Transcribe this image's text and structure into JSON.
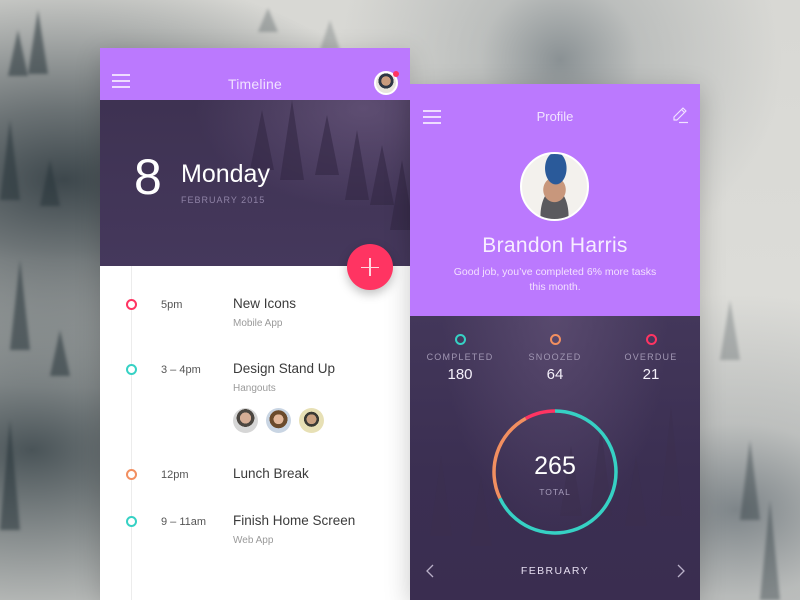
{
  "colors": {
    "accent_purple": "#bb79fe",
    "dark_purple": "#41355a",
    "fab_red": "#ff3462",
    "teal": "#36d1c4",
    "orange": "#f28f60",
    "red": "#ff3462"
  },
  "timeline": {
    "title": "Timeline",
    "menu_icon": "hamburger-menu-icon",
    "avatar_icon": "user-avatar",
    "notification": "notification-dot",
    "date": {
      "day": "8",
      "weekday": "Monday",
      "month_year": "FEBRUARY 2015"
    },
    "add_button": "+",
    "events": [
      {
        "time": "5pm",
        "title": "New Icons",
        "subtitle": "Mobile App",
        "color": "#ff3462"
      },
      {
        "time": "3 – 4pm",
        "title": "Design Stand Up",
        "subtitle": "Hangouts",
        "color": "#36d1c4",
        "attendees": 3
      },
      {
        "time": "12pm",
        "title": "Lunch Break",
        "subtitle": "",
        "color": "#f28f60"
      },
      {
        "time": "9 – 11am",
        "title": "Finish Home Screen",
        "subtitle": "Web App",
        "color": "#36d1c4"
      }
    ]
  },
  "profile": {
    "title": "Profile",
    "menu_icon": "hamburger-menu-icon",
    "edit_icon": "pencil-icon",
    "name": "Brandon Harris",
    "message": "Good job, you’ve completed 6% more tasks this month.",
    "stats": [
      {
        "label": "COMPLETED",
        "value": "180",
        "color": "#36d1c4"
      },
      {
        "label": "SNOOZED",
        "value": "64",
        "color": "#f28f60"
      },
      {
        "label": "OVERDUE",
        "value": "21",
        "color": "#ff3462"
      }
    ],
    "total": {
      "value": "265",
      "label": "TOTAL"
    },
    "month_nav": {
      "label": "FEBRUARY",
      "prev_icon": "chevron-left-icon",
      "next_icon": "chevron-right-icon"
    }
  }
}
